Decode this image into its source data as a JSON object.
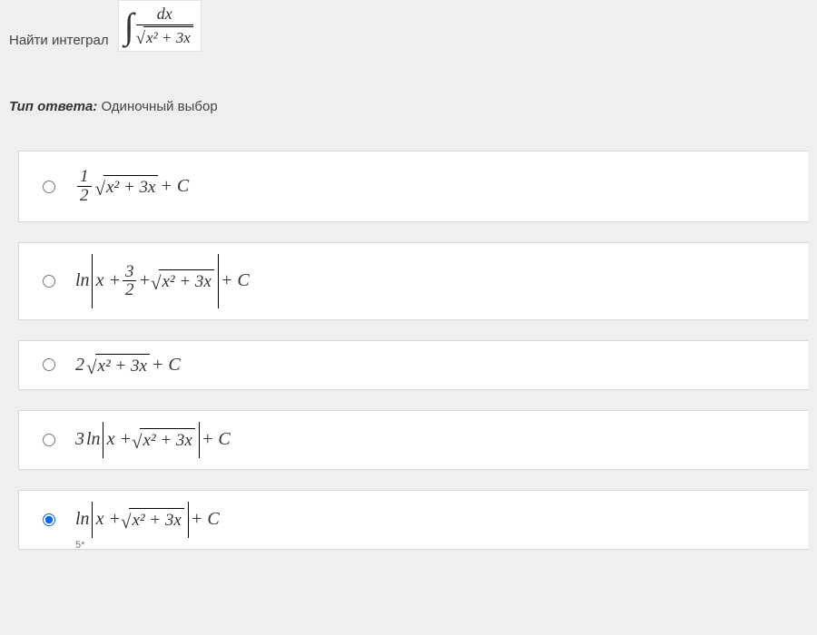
{
  "question": {
    "label": "Найти интеграл",
    "integral": {
      "numerator": "dx",
      "radicand": "x² + 3x"
    }
  },
  "answer_type": {
    "label": "Тип ответа:",
    "value": "Одиночный выбор"
  },
  "options": {
    "opt1": {
      "frac_num": "1",
      "frac_den": "2",
      "radicand": "x² + 3x",
      "tail": " + C"
    },
    "opt2": {
      "ln": "ln",
      "abs_lead": "x + ",
      "frac_num": "3",
      "frac_den": "2",
      "abs_mid": " + ",
      "radicand": "x² + 3x",
      "tail": " + C"
    },
    "opt3": {
      "coeff": "2",
      "radicand": "x² + 3x",
      "tail": " + C"
    },
    "opt4": {
      "coeff": "3",
      "ln": "ln",
      "abs_lead": "x + ",
      "radicand": "x² + 3x",
      "tail": " + C"
    },
    "opt5": {
      "ln": "ln",
      "abs_lead": "x + ",
      "radicand": "x² + 3x",
      "tail": " + C",
      "marker": "5*"
    }
  },
  "selected": 5
}
